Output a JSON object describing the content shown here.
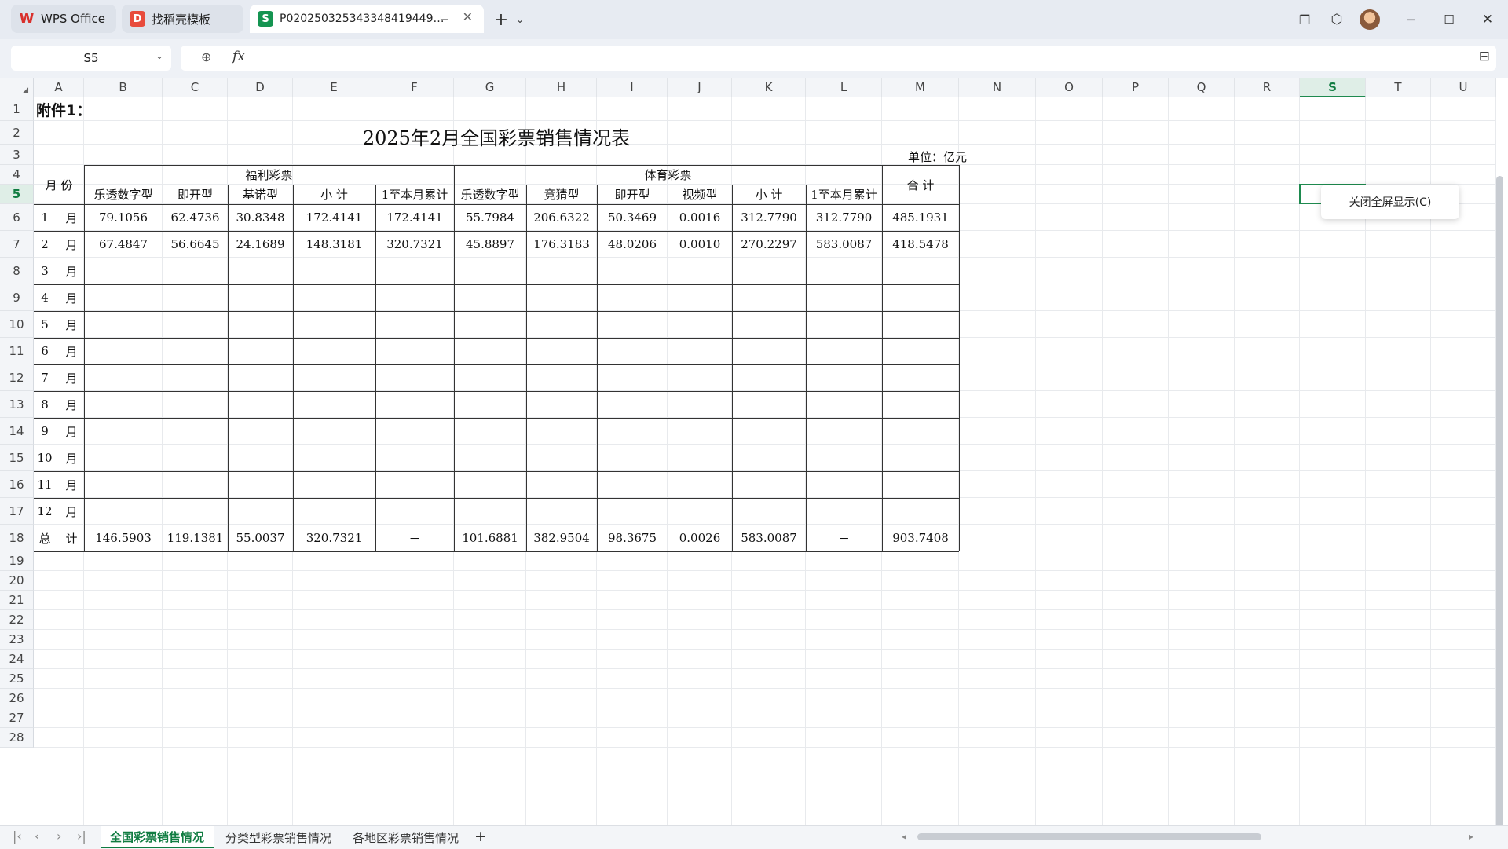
{
  "tabs": [
    {
      "label": "WPS Office",
      "icon": "wps-logo-icon"
    },
    {
      "label": "找稻壳模板",
      "icon": "docer-icon"
    },
    {
      "label": "P020250325343348419449…",
      "icon": "spreadsheet-icon"
    }
  ],
  "namebox": {
    "value": "S5"
  },
  "formula": {
    "fx_label": "fx",
    "value": ""
  },
  "columns": [
    "A",
    "B",
    "C",
    "D",
    "E",
    "F",
    "G",
    "H",
    "I",
    "J",
    "K",
    "L",
    "M",
    "N",
    "O",
    "P",
    "Q",
    "R",
    "S",
    "T",
    "U"
  ],
  "selected_column": "S",
  "rows": [
    "1",
    "2",
    "3",
    "4",
    "5",
    "6",
    "7",
    "8",
    "9",
    "10",
    "11",
    "12",
    "13",
    "14",
    "15",
    "16",
    "17",
    "18",
    "19",
    "20",
    "21",
    "22",
    "23",
    "24",
    "25",
    "26",
    "27",
    "28"
  ],
  "selected_row": "5",
  "table": {
    "attachment": "附件1：",
    "title": "2025年2月全国彩票销售情况表",
    "unit": "单位：亿元",
    "month_header": "月 份",
    "welfare_header": "福利彩票",
    "sports_header": "体育彩票",
    "total_header": "合 计",
    "sub_headers": [
      "乐透数字型",
      "即开型",
      "基诺型",
      "小 计",
      "1至本月累计",
      "乐透数字型",
      "竞猜型",
      "即开型",
      "视频型",
      "小 计",
      "1至本月累计"
    ],
    "data_rows": [
      {
        "label": "1 月",
        "values": [
          "79.1056",
          "62.4736",
          "30.8348",
          "172.4141",
          "172.4141",
          "55.7984",
          "206.6322",
          "50.3469",
          "0.0016",
          "312.7790",
          "312.7790",
          "485.1931"
        ]
      },
      {
        "label": "2 月",
        "values": [
          "67.4847",
          "56.6645",
          "24.1689",
          "148.3181",
          "320.7321",
          "45.8897",
          "176.3183",
          "48.0206",
          "0.0010",
          "270.2297",
          "583.0087",
          "418.5478"
        ]
      },
      {
        "label": "3 月",
        "values": [
          "",
          "",
          "",
          "",
          "",
          "",
          "",
          "",
          "",
          "",
          "",
          ""
        ]
      },
      {
        "label": "4 月",
        "values": [
          "",
          "",
          "",
          "",
          "",
          "",
          "",
          "",
          "",
          "",
          "",
          ""
        ]
      },
      {
        "label": "5 月",
        "values": [
          "",
          "",
          "",
          "",
          "",
          "",
          "",
          "",
          "",
          "",
          "",
          ""
        ]
      },
      {
        "label": "6 月",
        "values": [
          "",
          "",
          "",
          "",
          "",
          "",
          "",
          "",
          "",
          "",
          "",
          ""
        ]
      },
      {
        "label": "7 月",
        "values": [
          "",
          "",
          "",
          "",
          "",
          "",
          "",
          "",
          "",
          "",
          "",
          ""
        ]
      },
      {
        "label": "8 月",
        "values": [
          "",
          "",
          "",
          "",
          "",
          "",
          "",
          "",
          "",
          "",
          "",
          ""
        ]
      },
      {
        "label": "9 月",
        "values": [
          "",
          "",
          "",
          "",
          "",
          "",
          "",
          "",
          "",
          "",
          "",
          ""
        ]
      },
      {
        "label": "10 月",
        "values": [
          "",
          "",
          "",
          "",
          "",
          "",
          "",
          "",
          "",
          "",
          "",
          ""
        ]
      },
      {
        "label": "11 月",
        "values": [
          "",
          "",
          "",
          "",
          "",
          "",
          "",
          "",
          "",
          "",
          "",
          ""
        ]
      },
      {
        "label": "12 月",
        "values": [
          "",
          "",
          "",
          "",
          "",
          "",
          "",
          "",
          "",
          "",
          "",
          ""
        ]
      },
      {
        "label": "总 计",
        "values": [
          "146.5903",
          "119.1381",
          "55.0037",
          "320.7321",
          "－",
          "101.6881",
          "382.9504",
          "98.3675",
          "0.0026",
          "583.0087",
          "－",
          "903.7408"
        ]
      }
    ]
  },
  "popup": {
    "label": "关闭全屏显示(C)"
  },
  "sheet_tabs": [
    "全国彩票销售情况",
    "分类型彩票销售情况",
    "各地区彩票销售情况"
  ],
  "active_sheet": "全国彩票销售情况",
  "add_sheet_label": "+",
  "colors": {
    "accent": "#107c41",
    "selection": "#1e8a4f"
  }
}
